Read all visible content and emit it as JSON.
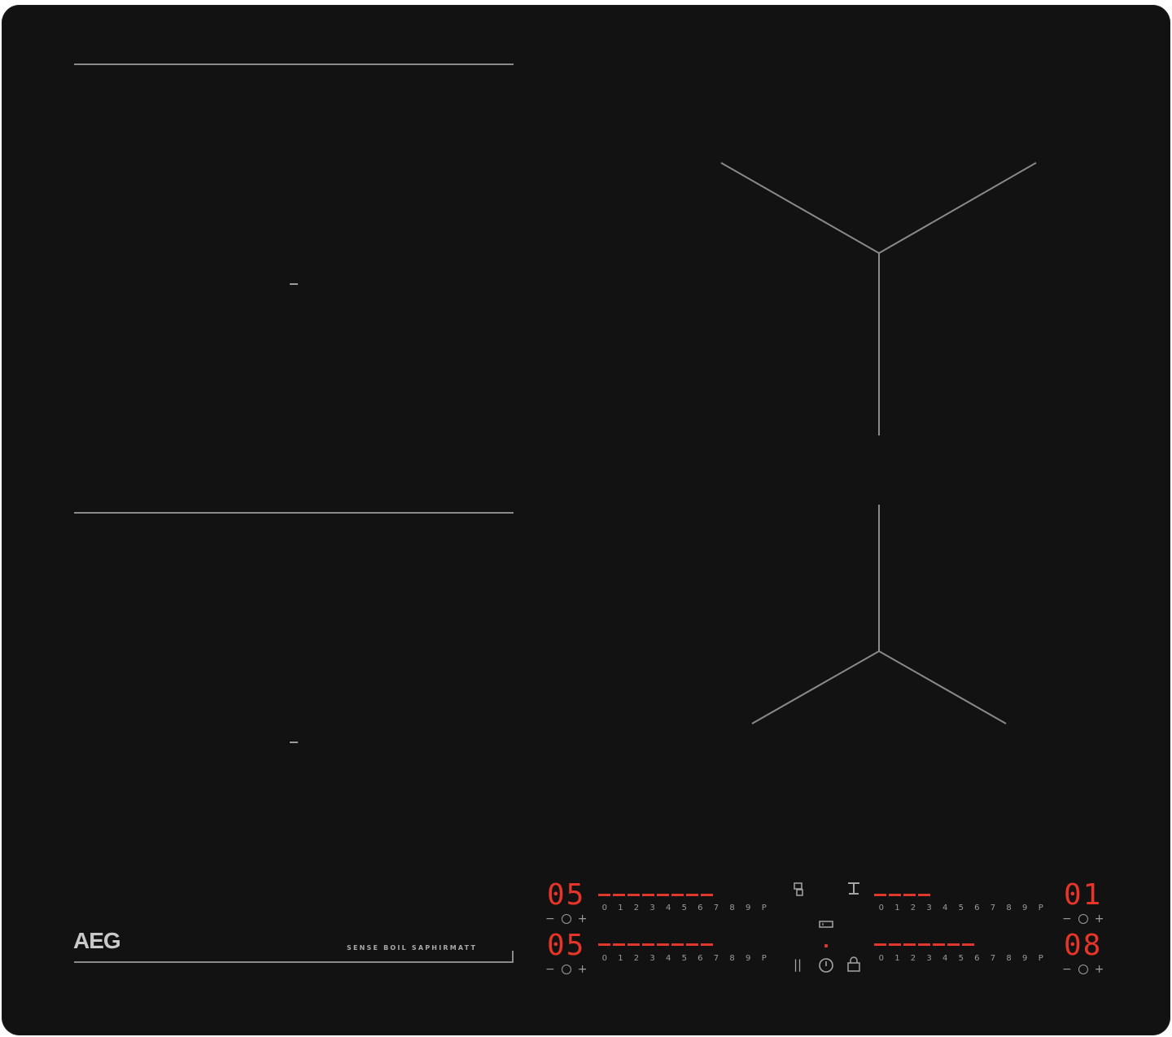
{
  "brand": {
    "logo": "AEG",
    "tagline": "SENSE BOIL SAPHIRMATT"
  },
  "colors": {
    "glass": "#121212",
    "marking": "#9a9a9a",
    "display_red": "#e8352a"
  },
  "power_scale": [
    "0",
    "1",
    "2",
    "3",
    "4",
    "5",
    "6",
    "7",
    "8",
    "9",
    "P"
  ],
  "zones": {
    "front_left": {
      "display": "05",
      "level_fraction": 0.8
    },
    "rear_left": {
      "display": "05",
      "level_fraction": 0.8
    },
    "rear_right": {
      "display": "01",
      "level_fraction": 0.4
    },
    "front_right": {
      "display": "08",
      "level_fraction": 0.7
    }
  },
  "timer_controls": {
    "minus": "−",
    "plus": "+"
  },
  "center_controls": {
    "pause_label": "||",
    "icons": [
      "hob2hood-icon",
      "bridge-icon",
      "keep-warm-icon",
      "power-icon",
      "lock-icon"
    ]
  }
}
